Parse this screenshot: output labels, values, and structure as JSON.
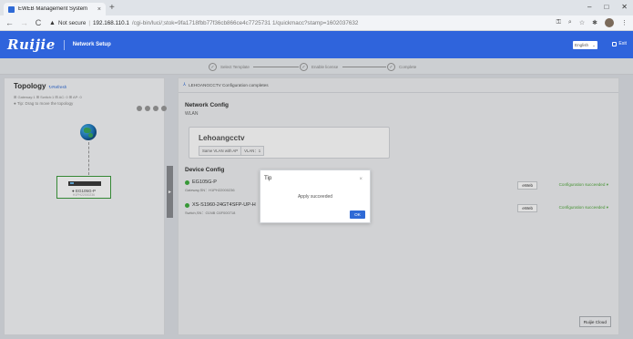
{
  "browser": {
    "tab_title": "EWEB Management System",
    "tab_close": "×",
    "new_tab": "+",
    "win_min": "–",
    "win_max": "□",
    "win_close": "✕",
    "back": "←",
    "forward": "→",
    "reload": "C",
    "warn_icon": "▲",
    "not_secure": "Not secure",
    "url_sep": "|",
    "url_host": "192.168.110.1",
    "url_rest": "/cgi-bin/luci/;stok=9fa1718fbb77f36cb866ce4c7725731 1/quickmacc?stamp=1602037632",
    "icons": [
      "key-icon",
      "zoom-icon",
      "star-icon",
      "extensions-icon",
      "avatar",
      "menu-icon"
    ],
    "key": "⚿",
    "zoom": "⌕",
    "star": "☆",
    "ext": "✱",
    "menu": "⋮"
  },
  "header": {
    "logo": "Ruijie",
    "title": "Network Setup",
    "language": "English",
    "language_caret": "⌄",
    "exit": "Exit"
  },
  "steps": [
    {
      "label": "Select Template",
      "check": "✓"
    },
    {
      "label": "Enable license",
      "check": "✓"
    },
    {
      "label": "Complete",
      "check": "✓"
    }
  ],
  "topology": {
    "title": "Topology",
    "refresh": "↻Refresh",
    "counts": "⊞ Gateway:1  ⊞ Switch:1  ⊞ AC: 0  ⊞ AP: 0",
    "tip": "● Tip: Drag to move the topology",
    "device_name": "● EG105G-P",
    "device_sn": "H1PH22000236"
  },
  "collapse_arrow": "►",
  "config": {
    "banner_icon": "⅄",
    "banner": "LEHOANGCCTV Configuration completes",
    "network_title": "Network Config",
    "network_sub": "WLAN",
    "wlan_name": "Lehoangcctv",
    "pill_1": "Same VLAN with AP",
    "pill_2": "VLAN：1",
    "device_title": "Device Config",
    "devices": [
      {
        "name": "EG105G-P",
        "sn": "Gateway,SN：H1PH22000236",
        "eweb": "eWeb",
        "status": "Configuration succeeded ▾"
      },
      {
        "name": "XS-S1960-24GT4SFP-UP-H",
        "sn": "Switch,SN：G1NB C6F000718",
        "eweb": "eWeb",
        "status": "Configuration succeeded ▾"
      }
    ],
    "cloud_button": "Ruijie Cloud"
  },
  "dialog": {
    "title": "Tip",
    "close": "×",
    "message": "Apply succeeded",
    "ok": "OK"
  }
}
